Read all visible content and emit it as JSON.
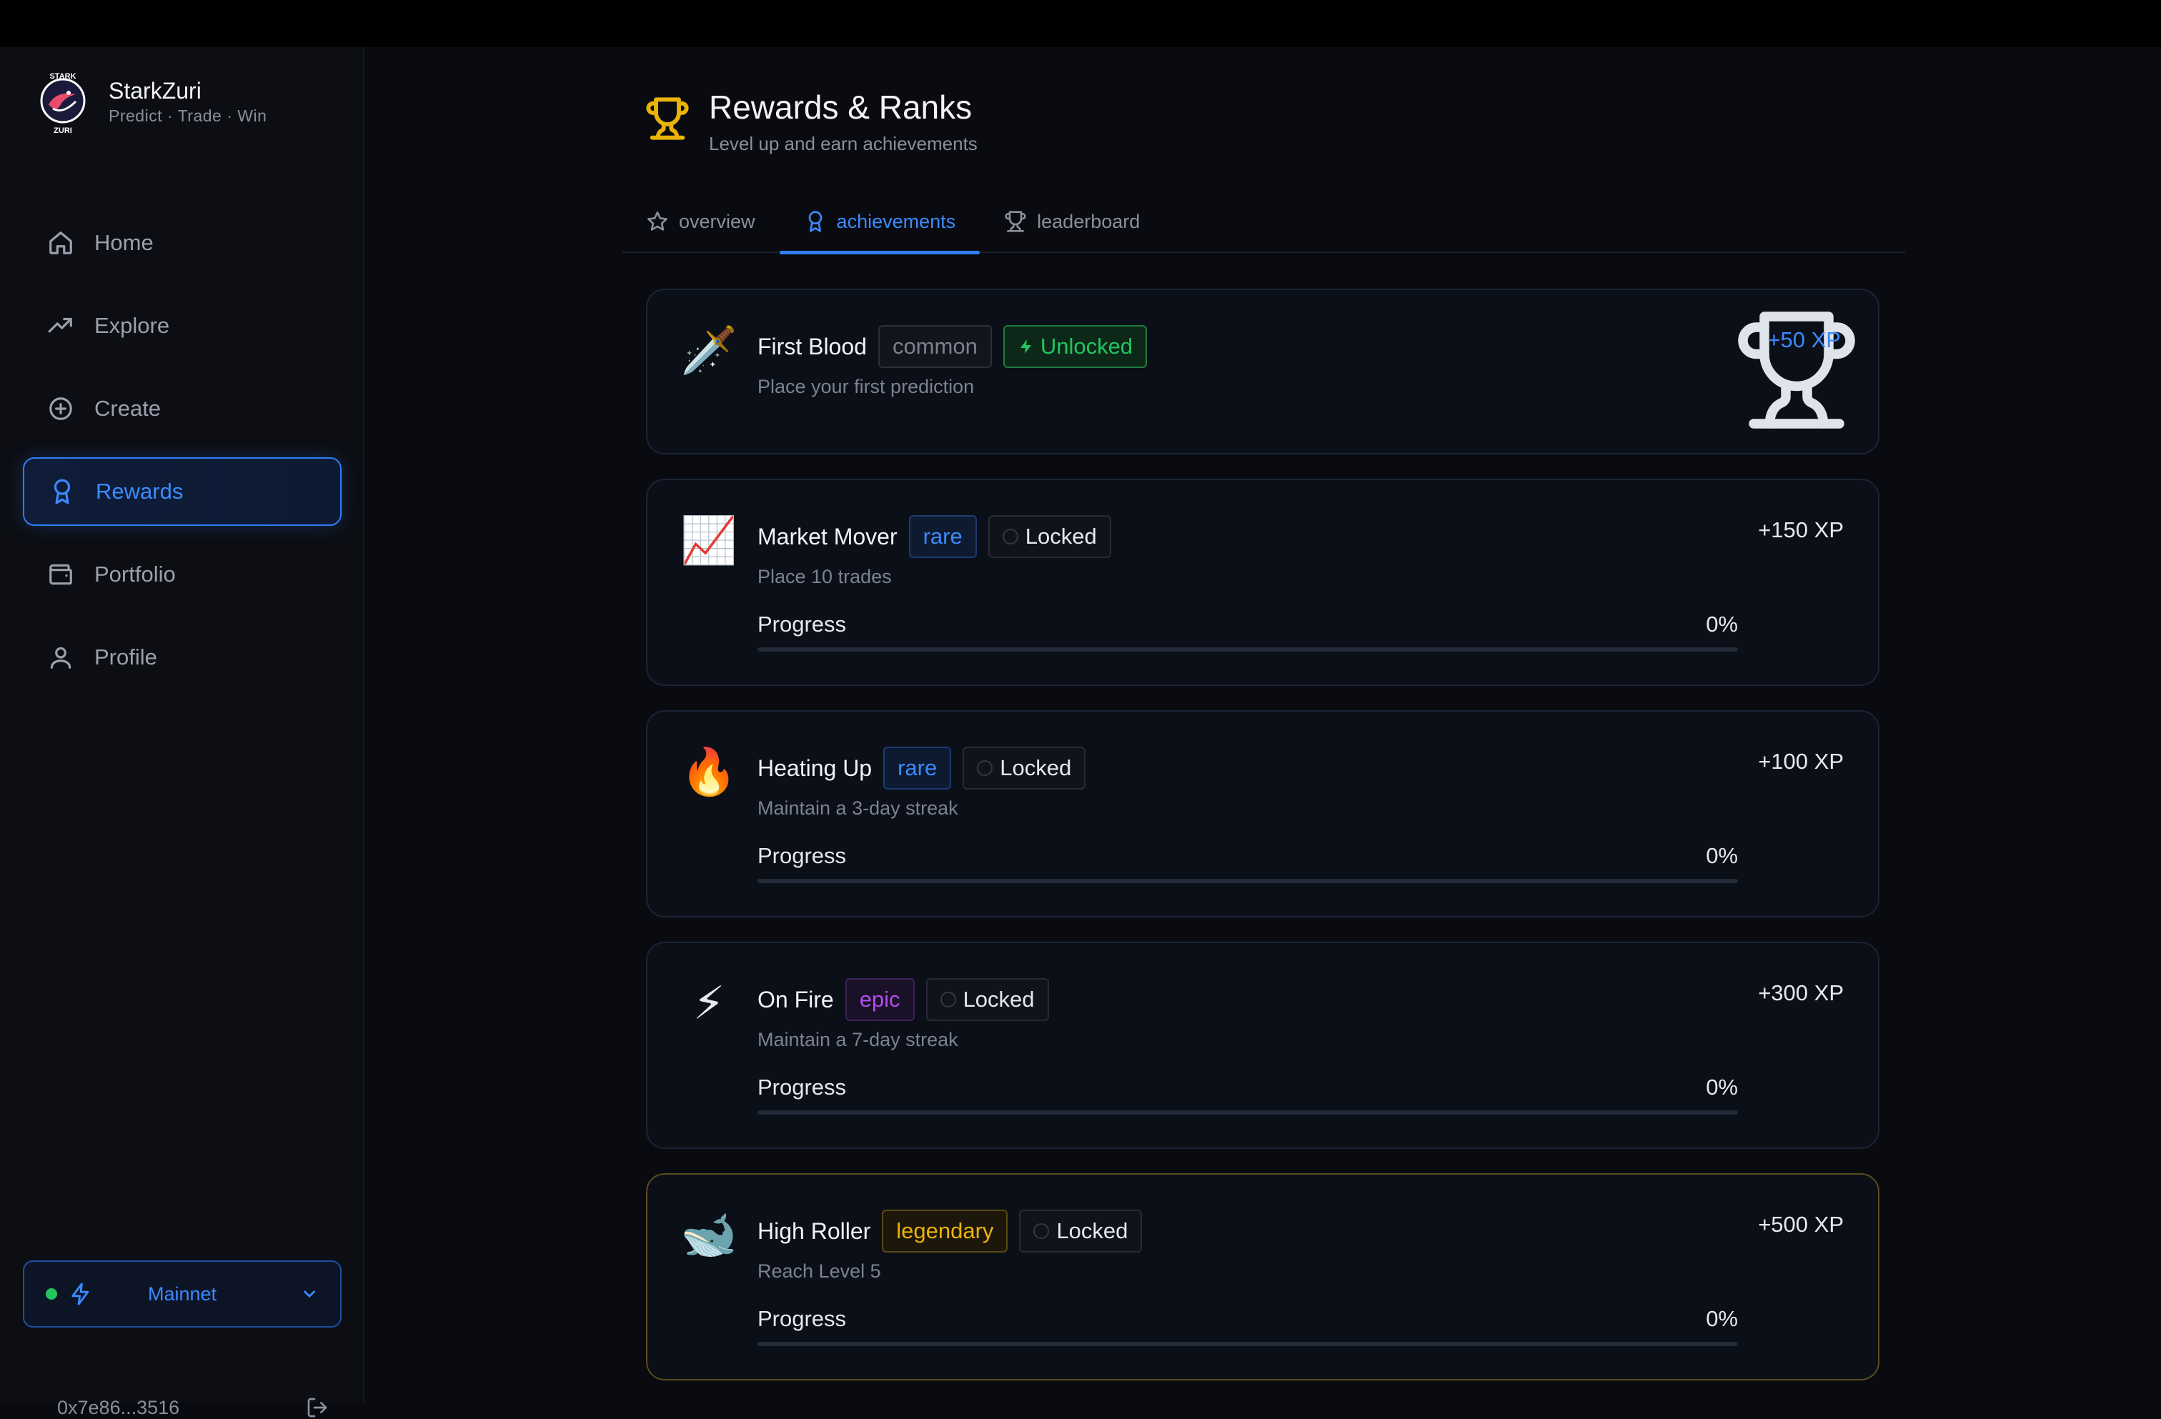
{
  "brand": {
    "name": "StarkZuri",
    "tagline": "Predict · Trade · Win",
    "logo_text_top": "STARK",
    "logo_text_bottom": "ZURI"
  },
  "sidebar": {
    "items": [
      {
        "label": "Home",
        "icon": "home-icon"
      },
      {
        "label": "Explore",
        "icon": "trending-icon"
      },
      {
        "label": "Create",
        "icon": "plus-circle-icon"
      },
      {
        "label": "Rewards",
        "icon": "award-icon",
        "active": true
      },
      {
        "label": "Portfolio",
        "icon": "wallet-icon"
      },
      {
        "label": "Profile",
        "icon": "user-icon"
      }
    ],
    "network": "Mainnet",
    "wallet_address": "0x7e86...3516"
  },
  "page": {
    "title": "Rewards & Ranks",
    "subtitle": "Level up and earn achievements"
  },
  "tabs": [
    {
      "label": "overview",
      "icon": "star-icon"
    },
    {
      "label": "achievements",
      "icon": "award-icon",
      "active": true
    },
    {
      "label": "leaderboard",
      "icon": "trophy-icon"
    }
  ],
  "achievements": [
    {
      "icon": "🗡️",
      "title": "First Blood",
      "rarity": "common",
      "status": "Unlocked",
      "description": "Place your first prediction",
      "xp": "+50 XP"
    },
    {
      "icon": "📈",
      "title": "Market Mover",
      "rarity": "rare",
      "status": "Locked",
      "description": "Place 10 trades",
      "xp": "+150 XP",
      "progress_label": "Progress",
      "progress": "0%"
    },
    {
      "icon": "🔥",
      "title": "Heating Up",
      "rarity": "rare",
      "status": "Locked",
      "description": "Maintain a 3-day streak",
      "xp": "+100 XP",
      "progress_label": "Progress",
      "progress": "0%"
    },
    {
      "icon": "⚡",
      "title": "On Fire",
      "rarity": "epic",
      "status": "Locked",
      "description": "Maintain a 7-day streak",
      "xp": "+300 XP",
      "progress_label": "Progress",
      "progress": "0%"
    },
    {
      "icon": "🐋",
      "title": "High Roller",
      "rarity": "legendary",
      "status": "Locked",
      "description": "Reach Level 5",
      "xp": "+500 XP",
      "progress_label": "Progress",
      "progress": "0%"
    }
  ],
  "colors": {
    "accent": "#2f7ff5",
    "success": "#22c55e",
    "epic": "#b14df0",
    "legendary": "#eab308",
    "background": "#0a0b10"
  }
}
